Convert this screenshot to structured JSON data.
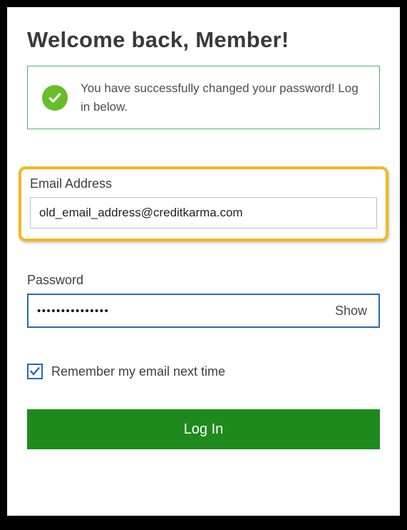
{
  "title": "Welcome back, Member!",
  "alert": {
    "message": "You have successfully changed your password! Log in in below.",
    "message_line1_2": "You have successfully changed your password! Log in below."
  },
  "email": {
    "label": "Email Address",
    "value": "old_email_address@creditkarma.com"
  },
  "password": {
    "label": "Password",
    "value": "•••••••••••••••",
    "show_label": "Show"
  },
  "remember": {
    "label": "Remember my email next time",
    "checked": true
  },
  "login_button": "Log In"
}
